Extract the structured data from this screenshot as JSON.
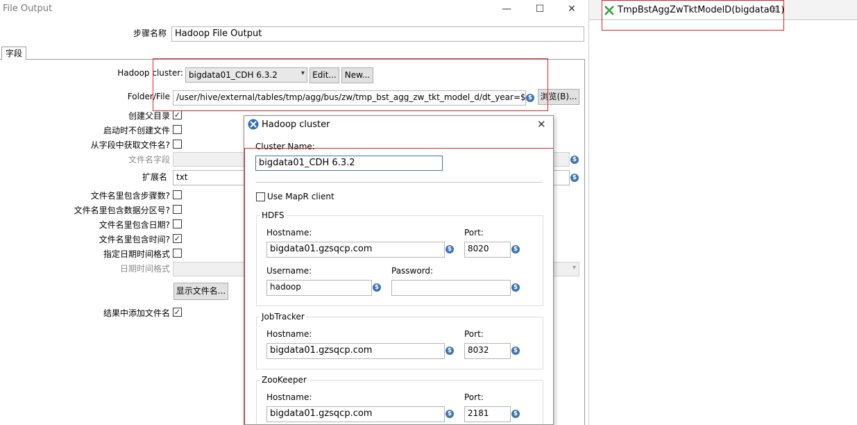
{
  "main_window": {
    "title": "File Output",
    "controls": {
      "minimize": "—",
      "maximize": "☐",
      "close": "✕"
    },
    "step_name_label": "步骤名称",
    "step_name_value": "Hadoop File Output",
    "tab_fields": "字段",
    "hadoop_cluster_label": "Hadoop cluster:",
    "hadoop_cluster_value": "bigdata01_CDH 6.3.2",
    "edit_button": "Edit...",
    "new_button": "New...",
    "folder_label": "Folder/File",
    "folder_value": "/user/hive/external/tables/tmp/agg/bus/zw/tmp_bst_agg_zw_tkt_model_d/dt_year=${D",
    "browse_button": "浏览(B)...",
    "create_parent_label": "创建父目录",
    "create_parent_checked": "✓",
    "no_create_on_start_label": "启动时不创建文件",
    "filename_from_field_label": "从字段中获取文件名?",
    "filename_field_label": "文件名字段",
    "extension_label": "扩展名",
    "extension_value": "txt",
    "include_step_label": "文件名里包含步骤数?",
    "include_partition_label": "文件名里包含数据分区号?",
    "include_date_label": "文件名里包含日期?",
    "include_time_label": "文件名里包含时间?",
    "include_time_checked": "✓",
    "specify_format_label": "指定日期时间格式",
    "datetime_format_label": "日期时间格式",
    "show_filenames_button": "显示文件名...",
    "add_filename_to_result_label": "结果中添加文件名",
    "add_filename_checked": "✓"
  },
  "editor": {
    "tab_title": "TmpBstAggZwTktModelD(bigdata01)",
    "tab_close": "☒"
  },
  "dialog": {
    "title": "Hadoop cluster",
    "close": "✕",
    "cluster_name_label": "Cluster Name:",
    "cluster_name_value": "bigdata01_CDH 6.3.2",
    "use_mapr_label": "Use MapR client",
    "hdfs": {
      "title": "HDFS",
      "hostname_label": "Hostname:",
      "hostname_value": "bigdata01.gzsqcp.com",
      "port_label": "Port:",
      "port_value": "8020",
      "username_label": "Username:",
      "username_value": "hadoop",
      "password_label": "Password:",
      "password_value": ""
    },
    "jobtracker": {
      "title": "JobTracker",
      "hostname_label": "Hostname:",
      "hostname_value": "bigdata01.gzsqcp.com",
      "port_label": "Port:",
      "port_value": "8032"
    },
    "zookeeper": {
      "title": "ZooKeeper",
      "hostname_label": "Hostname:",
      "hostname_value": "bigdata01.gzsqcp.com",
      "port_label": "Port:",
      "port_value": "2181"
    }
  },
  "icons": {
    "variable": "$",
    "dropdown": "▾"
  },
  "colors": {
    "highlight_red": "#e02020",
    "variable_blue": "#3b73b0"
  }
}
